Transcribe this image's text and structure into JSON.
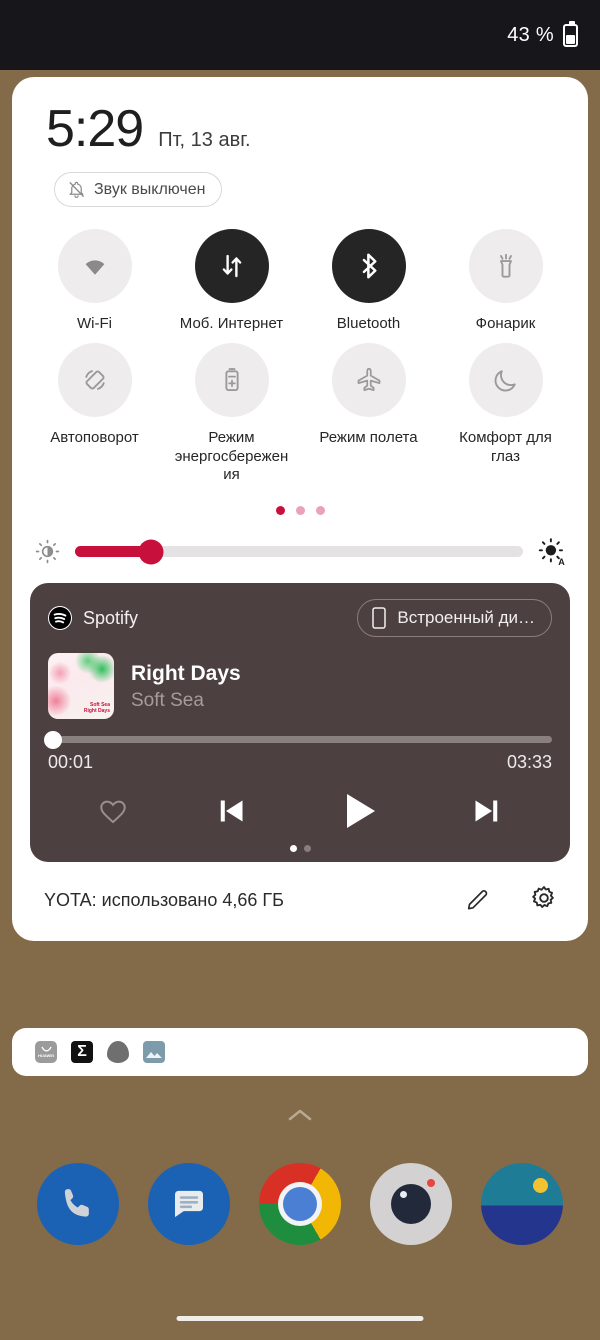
{
  "statusbar": {
    "battery_text": "43 %",
    "battery_icon": "battery-icon"
  },
  "quick_settings": {
    "clock": "5:29",
    "date": "Пт, 13 авг.",
    "mute_chip": {
      "label": "Звук выключен",
      "icon": "bell-slash-icon"
    },
    "tiles": [
      {
        "label": "Wi-Fi",
        "icon": "wifi-icon",
        "active": false
      },
      {
        "label": "Моб. Интернет",
        "icon": "mobile-data-icon",
        "active": true
      },
      {
        "label": "Bluetooth",
        "icon": "bluetooth-icon",
        "active": true
      },
      {
        "label": "Фонарик",
        "icon": "flashlight-icon",
        "active": false
      },
      {
        "label": "Автоповорот",
        "icon": "auto-rotate-icon",
        "active": false
      },
      {
        "label": "Режим энергосбережения",
        "icon": "battery-saver-icon",
        "active": false
      },
      {
        "label": "Режим полета",
        "icon": "airplane-icon",
        "active": false
      },
      {
        "label": "Комфорт для глаз",
        "icon": "eye-comfort-moon-icon",
        "active": false
      }
    ],
    "page_dots": {
      "count": 3,
      "active_index": 0
    },
    "brightness": {
      "value_percent": 17,
      "low_icon": "brightness-low-icon",
      "auto_icon": "brightness-auto-icon"
    },
    "footer": {
      "data_usage": "YOTA: использовано 4,66 ГБ",
      "edit_icon": "pencil-icon",
      "settings_icon": "gear-icon"
    }
  },
  "media_card": {
    "app_name": "Spotify",
    "app_icon": "spotify-icon",
    "device_chip": {
      "label": "Встроенный ди…",
      "icon": "phone-icon"
    },
    "album_art": {
      "line1": "Soft Sea",
      "line2": "Right Days"
    },
    "track_title": "Right Days",
    "track_artist": "Soft Sea",
    "elapsed": "00:01",
    "duration": "03:33",
    "progress_percent": 1,
    "controls": [
      {
        "name": "favorite-heart-icon"
      },
      {
        "name": "previous-track-icon"
      },
      {
        "name": "play-icon"
      },
      {
        "name": "next-track-icon"
      }
    ],
    "dots": {
      "count": 2,
      "active_index": 0
    },
    "background_color": "#4d4040"
  },
  "notification_shelf": {
    "icons": [
      {
        "name": "huawei-app-icon",
        "label": "HUAWEI"
      },
      {
        "name": "sigma-app-icon",
        "glyph": "Σ"
      },
      {
        "name": "blob-app-icon"
      },
      {
        "name": "photo-app-icon"
      }
    ]
  },
  "home_screen": {
    "drawer_chevron_icon": "chevron-up-icon",
    "dock": [
      {
        "name": "phone-app-icon"
      },
      {
        "name": "messages-app-icon"
      },
      {
        "name": "chrome-app-icon"
      },
      {
        "name": "camera-app-icon"
      },
      {
        "name": "photos-app-icon"
      }
    ],
    "home_indicator": "home-indicator"
  },
  "colors": {
    "accent": "#c8103c",
    "tile_on": "#262526",
    "tile_off": "#eeecec",
    "media_bg": "#4d4040"
  }
}
